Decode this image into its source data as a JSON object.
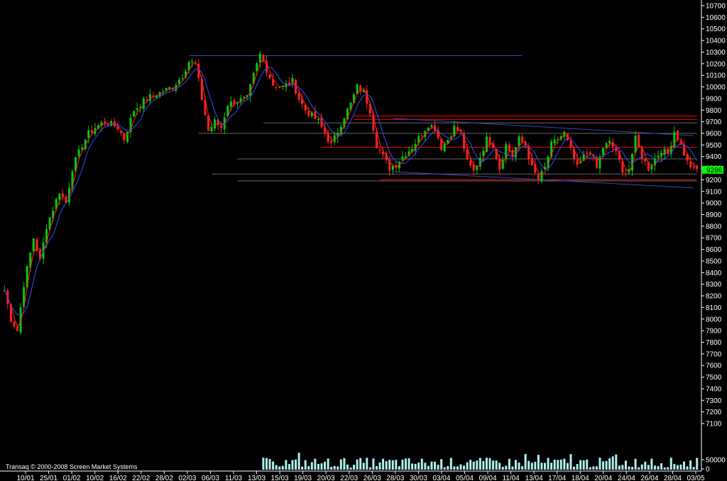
{
  "chart_data": {
    "type": "candlestick",
    "title": "",
    "watermark": "Transaq © 2000-2008 Screen Market Systems",
    "last_price_label": "9286",
    "colors": {
      "background": "#000000",
      "up": "#00cc00",
      "down": "#ff2020",
      "ma_fast": "#ff2020",
      "ma_slow": "#3050ff",
      "support_resistance": "#ff0000",
      "trendline": "#4040c0",
      "level_line": "#666666",
      "volume": "#b0f0f0",
      "last_price": "#00ff00",
      "text": "#ffffff"
    },
    "y_ticks": [
      "10700",
      "10600",
      "10500",
      "10400",
      "10300",
      "10200",
      "10100",
      "10000",
      "9900",
      "9800",
      "9700",
      "9600",
      "9500",
      "9400",
      "9300",
      "9200",
      "9100",
      "9000",
      "8900",
      "8800",
      "8700",
      "8600",
      "8500",
      "8400",
      "8300",
      "8200",
      "8100",
      "8000",
      "7900",
      "7800",
      "7700",
      "7600",
      "7500",
      "7400",
      "7300",
      "7200",
      "7100"
    ],
    "ylim": [
      7100,
      10700
    ],
    "volume_ticks": [
      "50000",
      "0"
    ],
    "x_ticks": [
      "10/01",
      "25/01",
      "01/02",
      "10/02",
      "16/02",
      "22/02",
      "28/02",
      "02/03",
      "06/03",
      "11/03",
      "13/03",
      "15/03",
      "19/03",
      "20/03",
      "22/03",
      "26/03",
      "28/03",
      "30/03",
      "03/04",
      "05/04",
      "09/04",
      "11/04",
      "13/04",
      "17/04",
      "18/04",
      "20/04",
      "24/04",
      "26/04",
      "28/04",
      "03/05"
    ],
    "price_path": [
      [
        0,
        8250
      ],
      [
        2,
        8000
      ],
      [
        4,
        7900
      ],
      [
        6,
        8300
      ],
      [
        9,
        8700
      ],
      [
        11,
        8500
      ],
      [
        13,
        8800
      ],
      [
        17,
        9100
      ],
      [
        19,
        9000
      ],
      [
        21,
        9300
      ],
      [
        24,
        9500
      ],
      [
        26,
        9600
      ],
      [
        28,
        9650
      ],
      [
        31,
        9700
      ],
      [
        35,
        9650
      ],
      [
        37,
        9550
      ],
      [
        40,
        9800
      ],
      [
        44,
        9900
      ],
      [
        48,
        9950
      ],
      [
        52,
        10000
      ],
      [
        55,
        10100
      ],
      [
        57,
        10220
      ],
      [
        59,
        10200
      ],
      [
        61,
        9900
      ],
      [
        63,
        9620
      ],
      [
        65,
        9700
      ],
      [
        67,
        9650
      ],
      [
        69,
        9850
      ],
      [
        72,
        9880
      ],
      [
        75,
        9900
      ],
      [
        77,
        10100
      ],
      [
        79,
        10280
      ],
      [
        81,
        10150
      ],
      [
        83,
        10020
      ],
      [
        86,
        10000
      ],
      [
        89,
        10050
      ],
      [
        91,
        9900
      ],
      [
        93,
        9800
      ],
      [
        95,
        9750
      ],
      [
        97,
        9700
      ],
      [
        99,
        9600
      ],
      [
        101,
        9500
      ],
      [
        103,
        9620
      ],
      [
        105,
        9750
      ],
      [
        107,
        9850
      ],
      [
        109,
        10000
      ],
      [
        111,
        9950
      ],
      [
        113,
        9800
      ],
      [
        115,
        9500
      ],
      [
        117,
        9400
      ],
      [
        119,
        9300
      ],
      [
        121,
        9340
      ],
      [
        123,
        9400
      ],
      [
        126,
        9480
      ],
      [
        129,
        9600
      ],
      [
        131,
        9680
      ],
      [
        133,
        9650
      ],
      [
        135,
        9480
      ],
      [
        137,
        9550
      ],
      [
        139,
        9650
      ],
      [
        141,
        9600
      ],
      [
        143,
        9350
      ],
      [
        145,
        9270
      ],
      [
        147,
        9400
      ],
      [
        149,
        9550
      ],
      [
        151,
        9500
      ],
      [
        153,
        9300
      ],
      [
        155,
        9500
      ],
      [
        157,
        9400
      ],
      [
        159,
        9550
      ],
      [
        161,
        9500
      ],
      [
        163,
        9300
      ],
      [
        165,
        9200
      ],
      [
        167,
        9300
      ],
      [
        169,
        9500
      ],
      [
        171,
        9550
      ],
      [
        173,
        9600
      ],
      [
        175,
        9450
      ],
      [
        177,
        9300
      ],
      [
        179,
        9400
      ],
      [
        181,
        9450
      ],
      [
        183,
        9300
      ],
      [
        185,
        9480
      ],
      [
        187,
        9520
      ],
      [
        189,
        9450
      ],
      [
        191,
        9250
      ],
      [
        193,
        9300
      ],
      [
        195,
        9550
      ],
      [
        197,
        9400
      ],
      [
        199,
        9300
      ],
      [
        201,
        9380
      ],
      [
        203,
        9460
      ],
      [
        205,
        9420
      ],
      [
        207,
        9620
      ],
      [
        209,
        9500
      ],
      [
        211,
        9350
      ],
      [
        213,
        9286
      ]
    ],
    "horizontal_lines": [
      {
        "y": 9750,
        "x0": 108,
        "x1": 220,
        "color": "support_resistance"
      },
      {
        "y": 9720,
        "x0": 108,
        "x1": 220,
        "color": "support_resistance"
      },
      {
        "y": 9690,
        "x0": 80,
        "x1": 220,
        "color": "level_line"
      },
      {
        "y": 9600,
        "x0": 60,
        "x1": 220,
        "color": "level_line"
      },
      {
        "y": 9480,
        "x0": 98,
        "x1": 220,
        "color": "support_resistance"
      },
      {
        "y": 9380,
        "x0": 72,
        "x1": 220,
        "color": "level_line"
      },
      {
        "y": 9250,
        "x0": 64,
        "x1": 220,
        "color": "level_line"
      },
      {
        "y": 9200,
        "x0": 116,
        "x1": 220,
        "color": "support_resistance"
      },
      {
        "y": 9190,
        "x0": 72,
        "x1": 220,
        "color": "level_line"
      },
      {
        "y": 10270,
        "x0": 57,
        "x1": 160,
        "color": "trendline"
      }
    ],
    "trendlines": [
      {
        "x0": 120,
        "y0": 9730,
        "x1": 213,
        "y1": 9580,
        "color": "trendline"
      },
      {
        "x0": 120,
        "y0": 9270,
        "x1": 213,
        "y1": 9130,
        "color": "trendline"
      }
    ]
  }
}
